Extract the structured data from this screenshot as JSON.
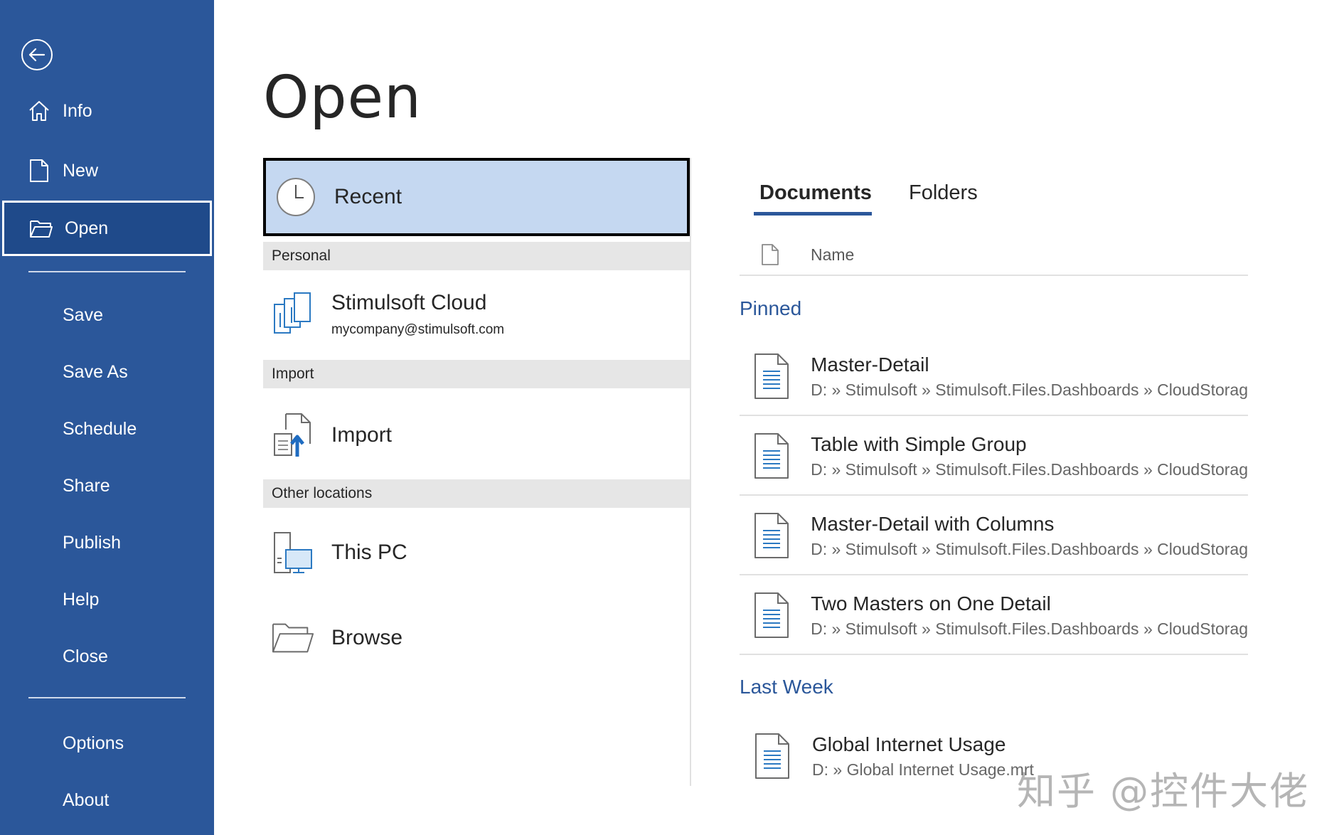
{
  "sidebar": {
    "back_icon": "back-arrow-icon",
    "items": [
      {
        "label": "Info",
        "icon": "home-icon"
      },
      {
        "label": "New",
        "icon": "new-document-icon"
      },
      {
        "label": "Open",
        "icon": "folder-open-icon",
        "active": true
      },
      {
        "label": "Save"
      },
      {
        "label": "Save As"
      },
      {
        "label": "Schedule"
      },
      {
        "label": "Share"
      },
      {
        "label": "Publish"
      },
      {
        "label": "Help"
      },
      {
        "label": "Close"
      },
      {
        "label": "Options"
      },
      {
        "label": "About"
      }
    ],
    "background_color": "#2b579a"
  },
  "page": {
    "title": "Open"
  },
  "locations": {
    "recent": {
      "label": "Recent",
      "icon": "clock-icon"
    },
    "sections": [
      {
        "title": "Personal",
        "items": [
          {
            "label": "Stimulsoft Cloud",
            "sub": "mycompany@stimulsoft.com",
            "icon": "cloud-storage-icon"
          }
        ]
      },
      {
        "title": "Import",
        "items": [
          {
            "label": "Import",
            "icon": "import-icon"
          }
        ]
      },
      {
        "title": "Other locations",
        "items": [
          {
            "label": "This PC",
            "icon": "this-pc-icon"
          },
          {
            "label": "Browse",
            "icon": "folder-browse-icon"
          }
        ]
      }
    ]
  },
  "files": {
    "tabs": [
      {
        "label": "Documents",
        "active": true
      },
      {
        "label": "Folders",
        "active": false
      }
    ],
    "column_header": "Name",
    "groups": [
      {
        "title": "Pinned",
        "items": [
          {
            "name": "Master-Detail",
            "path": "D: » Stimulsoft » Stimulsoft.Files.Dashboards » CloudStorag"
          },
          {
            "name": "Table with Simple Group",
            "path": "D: » Stimulsoft » Stimulsoft.Files.Dashboards » CloudStorag"
          },
          {
            "name": "Master-Detail with Columns",
            "path": "D: » Stimulsoft » Stimulsoft.Files.Dashboards » CloudStorag"
          },
          {
            "name": "Two Masters on One Detail",
            "path": "D: » Stimulsoft » Stimulsoft.Files.Dashboards » CloudStorag"
          }
        ]
      },
      {
        "title": "Last Week",
        "items": [
          {
            "name": "Global Internet Usage",
            "path": "D: » Global Internet Usage.mrt"
          }
        ]
      }
    ],
    "accent_color": "#2b579a"
  },
  "watermark": "知乎 @控件大佬"
}
